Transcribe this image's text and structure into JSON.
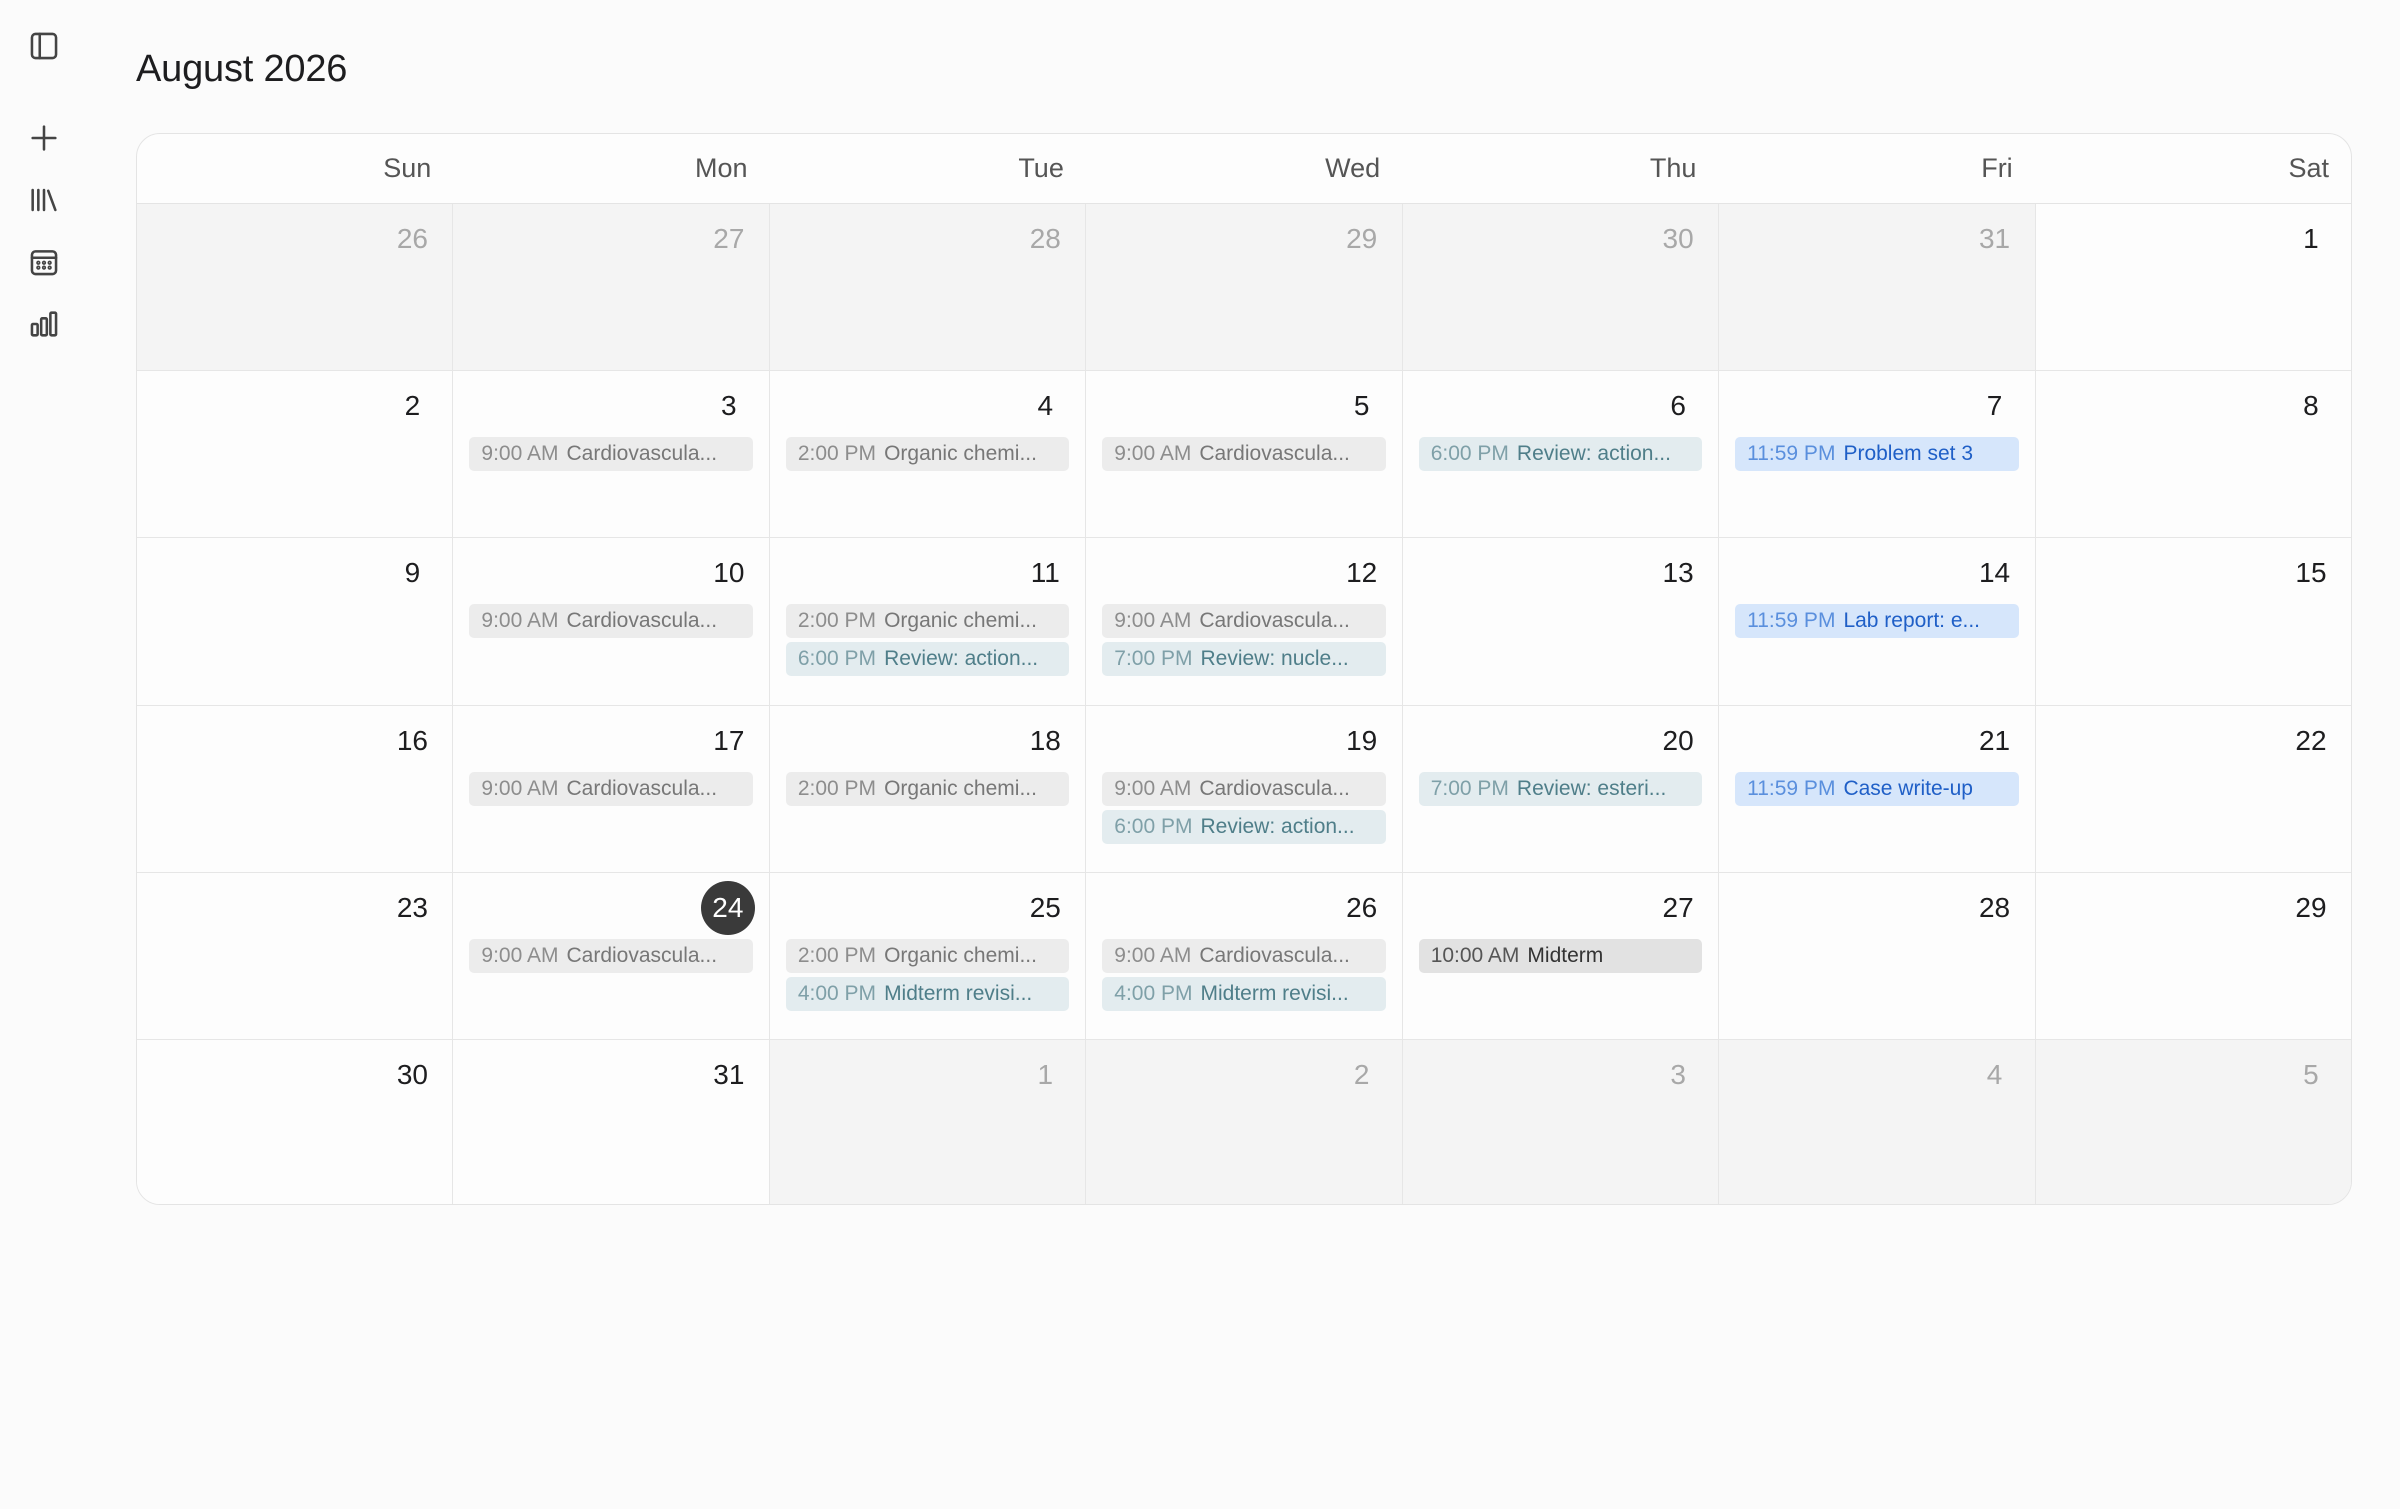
{
  "title": "August 2026",
  "sidebar": [
    {
      "name": "sidebar-toggle-icon"
    },
    {
      "name": "plus-icon"
    },
    {
      "name": "library-icon"
    },
    {
      "name": "calendar-icon"
    },
    {
      "name": "bar-chart-icon"
    }
  ],
  "weekdays": [
    "Sun",
    "Mon",
    "Tue",
    "Wed",
    "Thu",
    "Fri",
    "Sat"
  ],
  "weeks": [
    [
      {
        "day": "26",
        "other": true
      },
      {
        "day": "27",
        "other": true
      },
      {
        "day": "28",
        "other": true
      },
      {
        "day": "29",
        "other": true
      },
      {
        "day": "30",
        "other": true
      },
      {
        "day": "31",
        "other": true
      },
      {
        "day": "1"
      }
    ],
    [
      {
        "day": "2"
      },
      {
        "day": "3",
        "events": [
          {
            "time": "9:00 AM",
            "title": "Cardiovascula...",
            "style": "gray"
          }
        ]
      },
      {
        "day": "4",
        "events": [
          {
            "time": "2:00 PM",
            "title": "Organic chemi...",
            "style": "gray"
          }
        ]
      },
      {
        "day": "5",
        "events": [
          {
            "time": "9:00 AM",
            "title": "Cardiovascula...",
            "style": "gray"
          }
        ]
      },
      {
        "day": "6",
        "events": [
          {
            "time": "6:00 PM",
            "title": "Review: action...",
            "style": "teal"
          }
        ]
      },
      {
        "day": "7",
        "events": [
          {
            "time": "11:59 PM",
            "title": "Problem set 3",
            "style": "blue"
          }
        ]
      },
      {
        "day": "8"
      }
    ],
    [
      {
        "day": "9"
      },
      {
        "day": "10",
        "events": [
          {
            "time": "9:00 AM",
            "title": "Cardiovascula...",
            "style": "gray"
          }
        ]
      },
      {
        "day": "11",
        "events": [
          {
            "time": "2:00 PM",
            "title": "Organic chemi...",
            "style": "gray"
          },
          {
            "time": "6:00 PM",
            "title": "Review: action...",
            "style": "teal"
          }
        ]
      },
      {
        "day": "12",
        "events": [
          {
            "time": "9:00 AM",
            "title": "Cardiovascula...",
            "style": "gray"
          },
          {
            "time": "7:00 PM",
            "title": "Review: nucle...",
            "style": "teal"
          }
        ]
      },
      {
        "day": "13"
      },
      {
        "day": "14",
        "events": [
          {
            "time": "11:59 PM",
            "title": "Lab report: e...",
            "style": "blue"
          }
        ]
      },
      {
        "day": "15"
      }
    ],
    [
      {
        "day": "16"
      },
      {
        "day": "17",
        "events": [
          {
            "time": "9:00 AM",
            "title": "Cardiovascula...",
            "style": "gray"
          }
        ]
      },
      {
        "day": "18",
        "events": [
          {
            "time": "2:00 PM",
            "title": "Organic chemi...",
            "style": "gray"
          }
        ]
      },
      {
        "day": "19",
        "events": [
          {
            "time": "9:00 AM",
            "title": "Cardiovascula...",
            "style": "gray"
          },
          {
            "time": "6:00 PM",
            "title": "Review: action...",
            "style": "teal"
          }
        ]
      },
      {
        "day": "20",
        "events": [
          {
            "time": "7:00 PM",
            "title": "Review: esteri...",
            "style": "teal"
          }
        ]
      },
      {
        "day": "21",
        "events": [
          {
            "time": "11:59 PM",
            "title": "Case write-up",
            "style": "blue"
          }
        ]
      },
      {
        "day": "22"
      }
    ],
    [
      {
        "day": "23"
      },
      {
        "day": "24",
        "today": true,
        "events": [
          {
            "time": "9:00 AM",
            "title": "Cardiovascula...",
            "style": "gray"
          }
        ]
      },
      {
        "day": "25",
        "events": [
          {
            "time": "2:00 PM",
            "title": "Organic chemi...",
            "style": "gray"
          },
          {
            "time": "4:00 PM",
            "title": "Midterm revisi...",
            "style": "teal"
          }
        ]
      },
      {
        "day": "26",
        "events": [
          {
            "time": "9:00 AM",
            "title": "Cardiovascula...",
            "style": "gray"
          },
          {
            "time": "4:00 PM",
            "title": "Midterm revisi...",
            "style": "teal"
          }
        ]
      },
      {
        "day": "27",
        "events": [
          {
            "time": "10:00 AM",
            "title": "Midterm",
            "style": "dark"
          }
        ]
      },
      {
        "day": "28"
      },
      {
        "day": "29"
      }
    ],
    [
      {
        "day": "30"
      },
      {
        "day": "31"
      },
      {
        "day": "1",
        "other": true
      },
      {
        "day": "2",
        "other": true
      },
      {
        "day": "3",
        "other": true
      },
      {
        "day": "4",
        "other": true
      },
      {
        "day": "5",
        "other": true
      }
    ]
  ]
}
